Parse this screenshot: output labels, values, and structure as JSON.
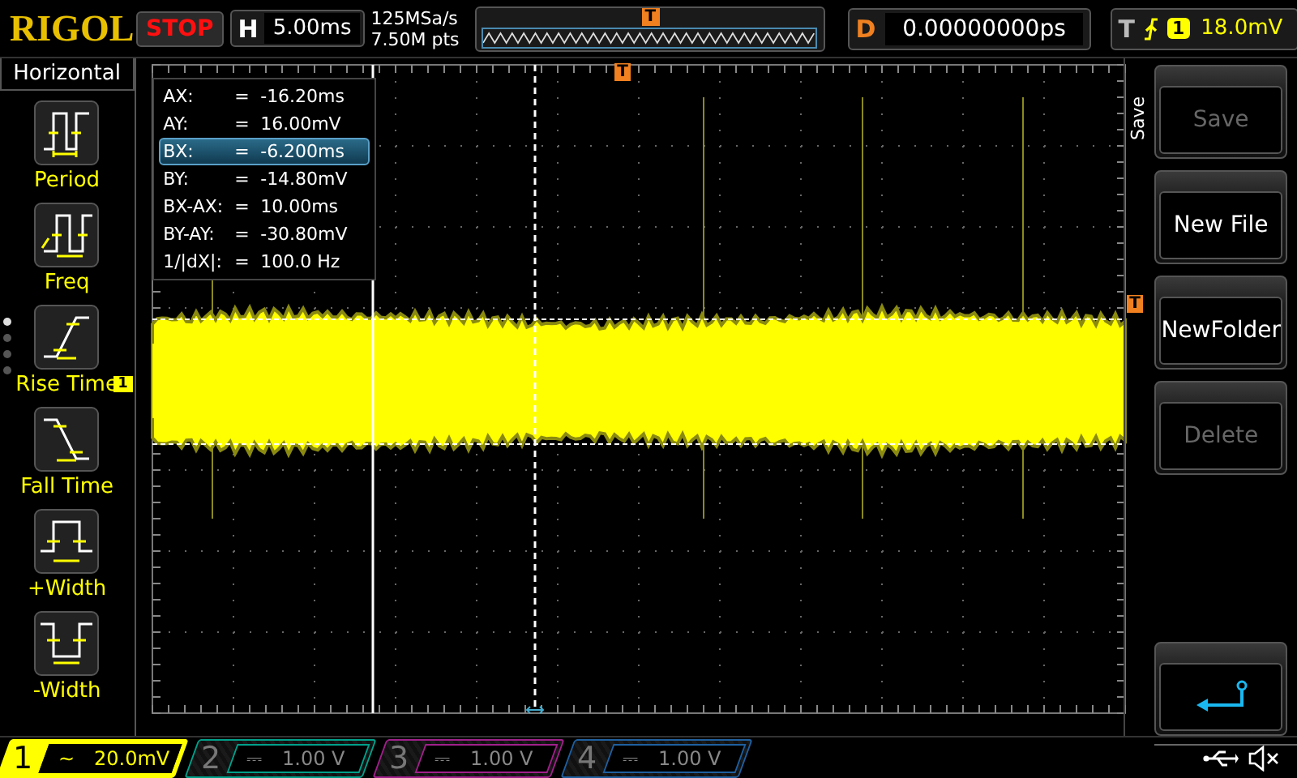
{
  "header": {
    "logo": "RIGOL",
    "run_state": "STOP",
    "timebase": {
      "label": "H",
      "value": "5.00ms"
    },
    "sample_rate": "125MSa/s",
    "memory_depth": "7.50M pts",
    "memory_trigger_marker": "T",
    "delay": {
      "label": "D",
      "value": "0.00000000ps"
    },
    "trigger": {
      "label": "T",
      "source": "1",
      "level": "18.0mV"
    }
  },
  "measure_menu": {
    "title": "Horizontal",
    "items": [
      {
        "label": "Period",
        "kind": "period"
      },
      {
        "label": "Freq",
        "kind": "freq"
      },
      {
        "label": "Rise Time",
        "kind": "rise"
      },
      {
        "label": "Fall Time",
        "kind": "fall"
      },
      {
        "label": "+Width",
        "kind": "pwidth"
      },
      {
        "label": "-Width",
        "kind": "nwidth"
      }
    ]
  },
  "display": {
    "trigger_position_marker": "T",
    "trigger_level_marker": "T",
    "channel_marker": "1"
  },
  "cursor_readout": {
    "rows": [
      {
        "name": "AX:",
        "eq": "=",
        "value": "-16.20ms",
        "selected": false
      },
      {
        "name": "AY:",
        "eq": "=",
        "value": "16.00mV",
        "selected": false
      },
      {
        "name": "BX:",
        "eq": "=",
        "value": "-6.200ms",
        "selected": true
      },
      {
        "name": "BY:",
        "eq": "=",
        "value": "-14.80mV",
        "selected": false
      },
      {
        "name": "BX-AX:",
        "eq": "=",
        "value": "10.00ms",
        "selected": false
      },
      {
        "name": "BY-AY:",
        "eq": "=",
        "value": "-30.80mV",
        "selected": false
      },
      {
        "name": "1/|dX|:",
        "eq": "=",
        "value": "100.0 Hz",
        "selected": false
      }
    ]
  },
  "softkeys": {
    "title": "Save",
    "buttons": [
      {
        "kind": "text",
        "label": "Save",
        "disabled": true
      },
      {
        "kind": "text",
        "label": "New File",
        "disabled": false
      },
      {
        "kind": "text",
        "label": "NewFolder",
        "disabled": false
      },
      {
        "kind": "text",
        "label": "Delete",
        "disabled": true
      },
      {
        "kind": "spacer"
      },
      {
        "kind": "back",
        "disabled": false
      }
    ]
  },
  "channels": [
    {
      "number": "1",
      "coupling": "~",
      "scale": "20.0mV",
      "on": true,
      "color": "#ffff00"
    },
    {
      "number": "2",
      "coupling": "⎓",
      "scale": "1.00 V",
      "on": false,
      "color": "#00a08a"
    },
    {
      "number": "3",
      "coupling": "⎓",
      "scale": "1.00 V",
      "on": false,
      "color": "#a0208a"
    },
    {
      "number": "4",
      "coupling": "⎓",
      "scale": "1.00 V",
      "on": false,
      "color": "#1f5f9f"
    }
  ]
}
